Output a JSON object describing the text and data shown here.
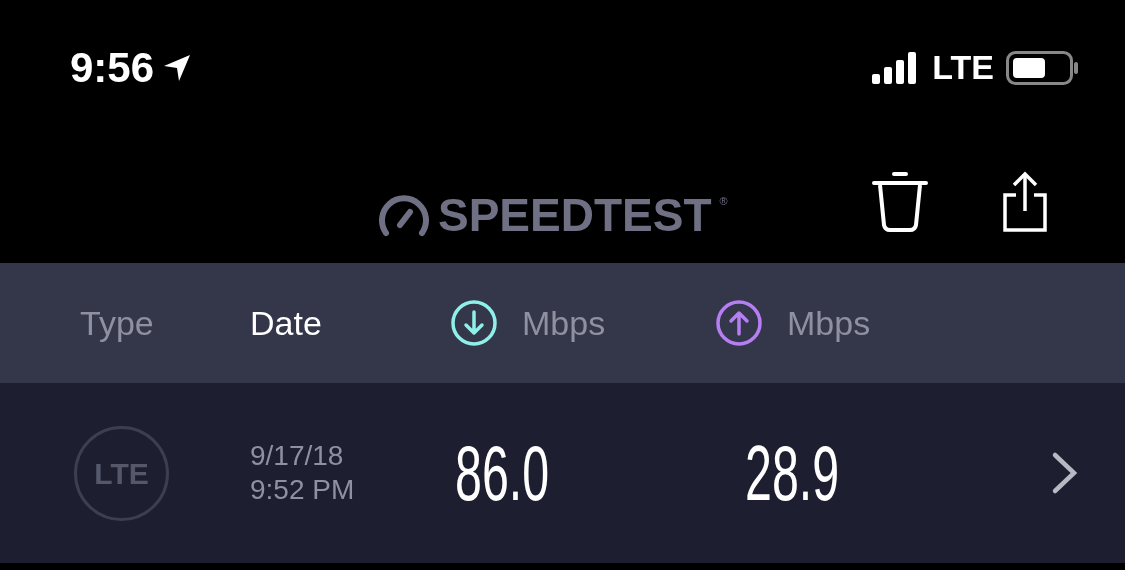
{
  "status_bar": {
    "time": "9:56",
    "location_on": true,
    "network": "LTE"
  },
  "header": {
    "logo": "SPEEDTEST",
    "trademark": "®"
  },
  "columns": [
    {
      "kind": "text",
      "label": "Type",
      "selected": false
    },
    {
      "kind": "text",
      "label": "Date",
      "selected": true
    },
    {
      "kind": "download",
      "label": "Mbps",
      "selected": false
    },
    {
      "kind": "upload",
      "label": "Mbps",
      "selected": false
    }
  ],
  "results": [
    {
      "type": "LTE",
      "date": "9/17/18",
      "time": "9:52 PM",
      "download": "86.0",
      "upload": "28.9"
    }
  ]
}
